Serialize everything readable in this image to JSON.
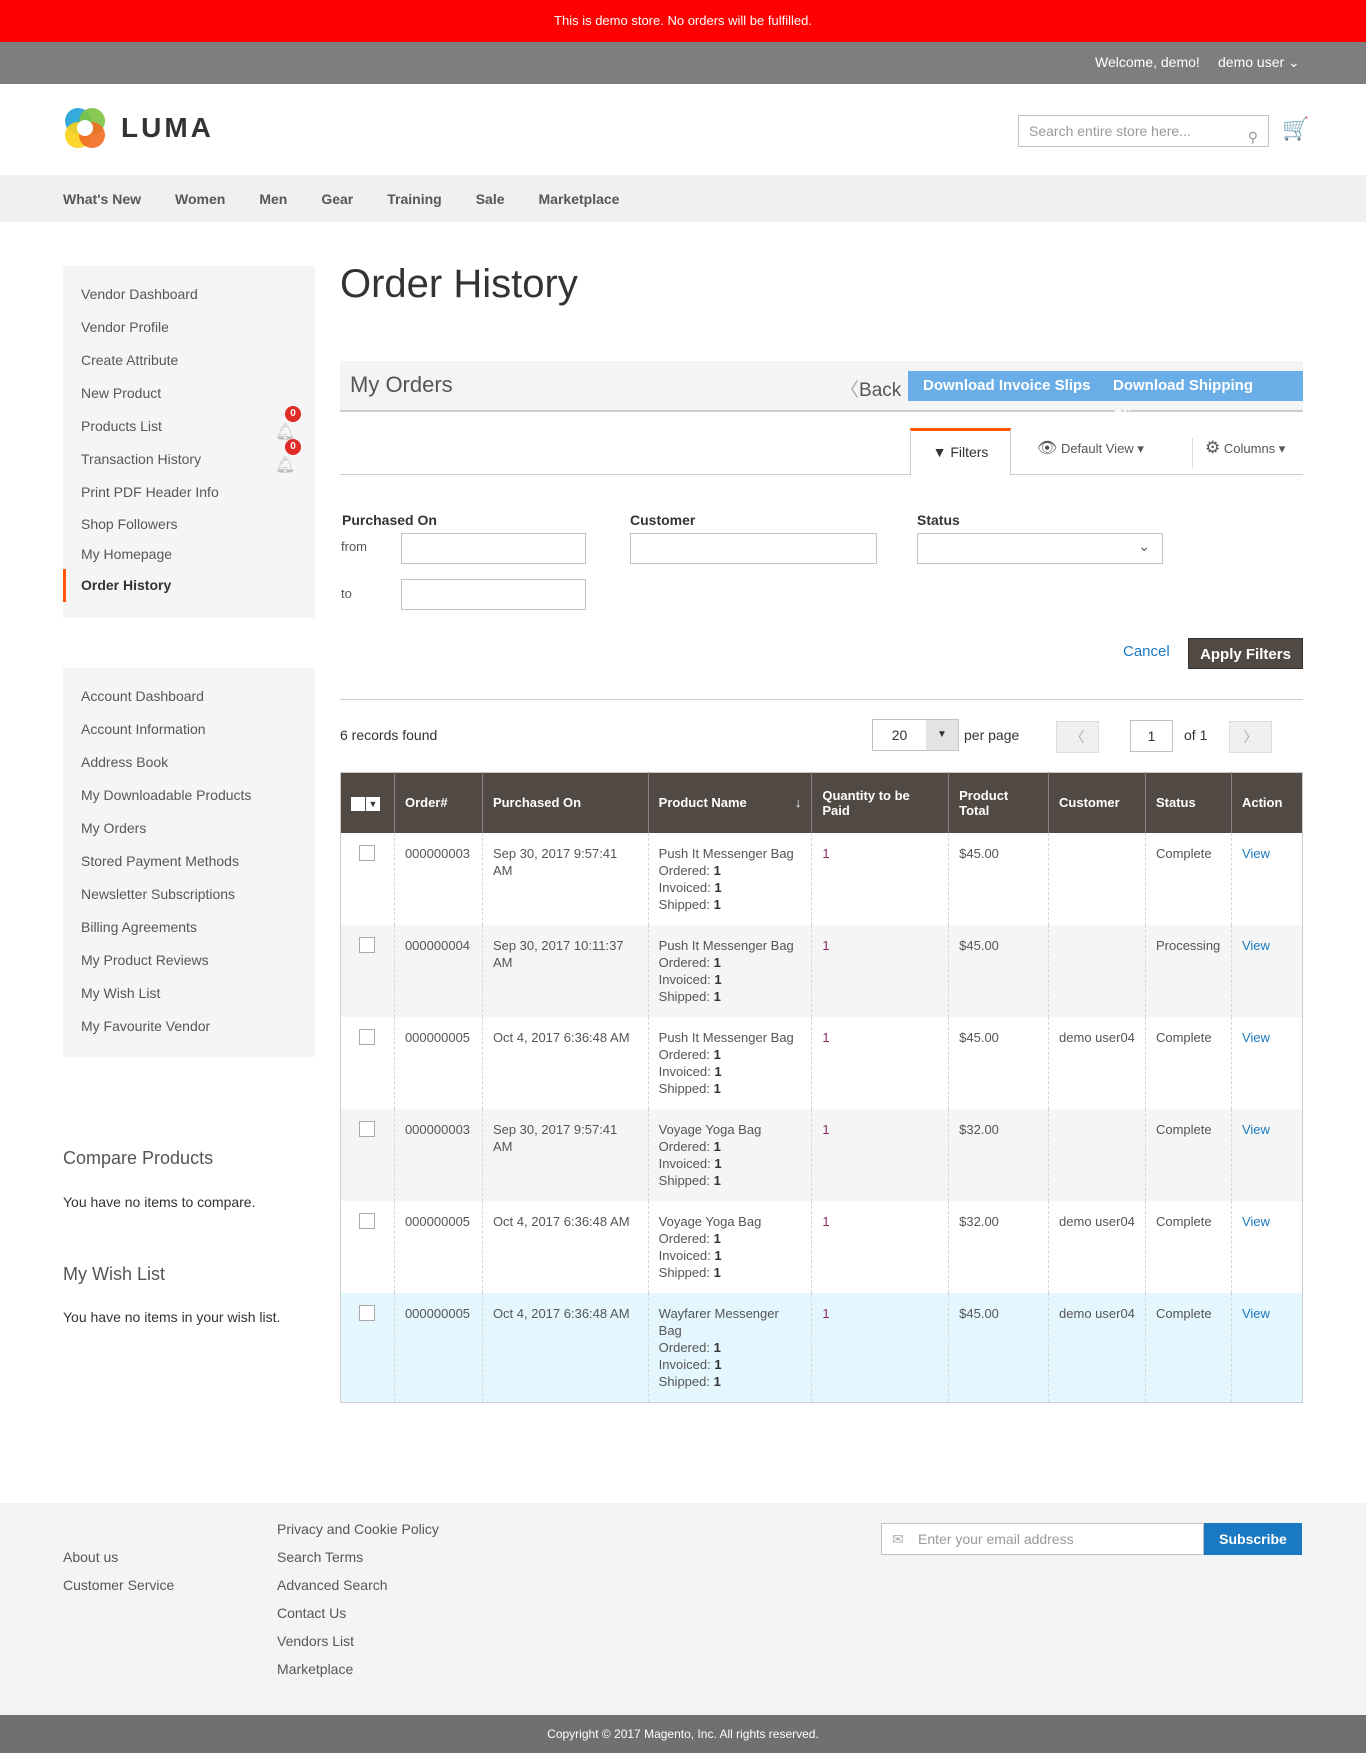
{
  "banner": "This is demo store. No orders will be fulfilled.",
  "topbar": {
    "welcome": "Welcome, demo!",
    "user": "demo user"
  },
  "logo": "LUMA",
  "search": {
    "placeholder": "Search entire store here..."
  },
  "nav": [
    "What's New",
    "Women",
    "Men",
    "Gear",
    "Training",
    "Sale",
    "Marketplace"
  ],
  "vendor_menu": [
    "Vendor Dashboard",
    "Vendor Profile",
    "Create Attribute",
    "New Product",
    "Products List",
    "Transaction History",
    "Print PDF Header Info",
    "Shop Followers",
    "My Homepage",
    "Order History"
  ],
  "badges": {
    "products_list": "0",
    "transaction_history": "0"
  },
  "account_menu": [
    "Account Dashboard",
    "Account Information",
    "Address Book",
    "My Downloadable Products",
    "My Orders",
    "Stored Payment Methods",
    "Newsletter Subscriptions",
    "Billing Agreements",
    "My Product Reviews",
    "My Wish List",
    "My Favourite Vendor"
  ],
  "compare": {
    "title": "Compare Products",
    "text": "You have no items to compare."
  },
  "wishlist": {
    "title": "My Wish List",
    "text": "You have no items in your wish list."
  },
  "page_title": "Order History",
  "orders": {
    "title": "My Orders",
    "back": "Back",
    "invoice": "Download Invoice Slips",
    "shipping": "Download Shipping Slips"
  },
  "toolbar": {
    "filters": "Filters",
    "view": "Default View",
    "columns": "Columns"
  },
  "filters": {
    "purchased": "Purchased On",
    "from": "from",
    "to": "to",
    "customer": "Customer",
    "status": "Status",
    "cancel": "Cancel",
    "apply": "Apply Filters"
  },
  "pager": {
    "records": "6 records found",
    "per_page_value": "20",
    "per_page": "per page",
    "page": "1",
    "of": "of 1"
  },
  "columns": [
    "Order#",
    "Purchased On",
    "Product Name",
    "Quantity to be Paid",
    "Product Total",
    "Customer",
    "Status",
    "Action"
  ],
  "labels": {
    "ordered": "Ordered: ",
    "invoiced": "Invoiced: ",
    "shipped": "Shipped: "
  },
  "rows": [
    {
      "order": "000000003",
      "date": "Sep 30, 2017 9:57:41 AM",
      "product": "Push It Messenger Bag",
      "ordered": "1",
      "invoiced": "1",
      "shipped": "1",
      "qty": "1",
      "total": "$45.00",
      "customer": "",
      "status": "Complete",
      "action": "View"
    },
    {
      "order": "000000004",
      "date": "Sep 30, 2017 10:11:37 AM",
      "product": "Push It Messenger Bag",
      "ordered": "1",
      "invoiced": "1",
      "shipped": "1",
      "qty": "1",
      "total": "$45.00",
      "customer": "",
      "status": "Processing",
      "action": "View"
    },
    {
      "order": "000000005",
      "date": "Oct 4, 2017 6:36:48 AM",
      "product": "Push It Messenger Bag",
      "ordered": "1",
      "invoiced": "1",
      "shipped": "1",
      "qty": "1",
      "total": "$45.00",
      "customer": "demo user04",
      "status": "Complete",
      "action": "View"
    },
    {
      "order": "000000003",
      "date": "Sep 30, 2017 9:57:41 AM",
      "product": "Voyage Yoga Bag",
      "ordered": "1",
      "invoiced": "1",
      "shipped": "1",
      "qty": "1",
      "total": "$32.00",
      "customer": "",
      "status": "Complete",
      "action": "View"
    },
    {
      "order": "000000005",
      "date": "Oct 4, 2017 6:36:48 AM",
      "product": "Voyage Yoga Bag",
      "ordered": "1",
      "invoiced": "1",
      "shipped": "1",
      "qty": "1",
      "total": "$32.00",
      "customer": "demo user04",
      "status": "Complete",
      "action": "View"
    },
    {
      "order": "000000005",
      "date": "Oct 4, 2017 6:36:48 AM",
      "product": "Wayfarer Messenger Bag",
      "ordered": "1",
      "invoiced": "1",
      "shipped": "1",
      "qty": "1",
      "total": "$45.00",
      "customer": "demo user04",
      "status": "Complete",
      "action": "View"
    }
  ],
  "footer": {
    "col1": [
      "About us",
      "Customer Service"
    ],
    "col2": [
      "Privacy and Cookie Policy",
      "Search Terms",
      "Advanced Search",
      "Contact Us",
      "Vendors List",
      "Marketplace"
    ],
    "email_placeholder": "Enter your email address",
    "subscribe": "Subscribe",
    "copyright": "Copyright © 2017 Magento, Inc. All rights reserved."
  }
}
